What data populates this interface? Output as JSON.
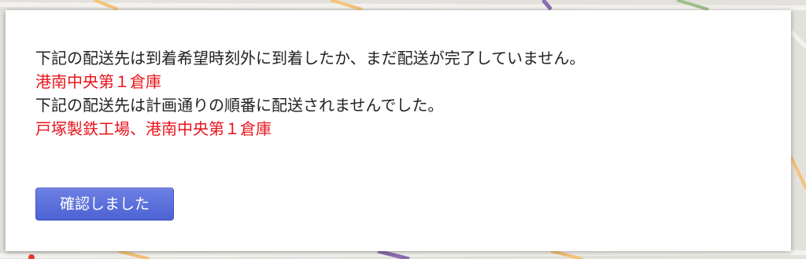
{
  "dialog": {
    "lines": [
      "下記の配送先は到着希望時刻外に到着したか、まだ配送が完了していません。",
      "港南中央第１倉庫",
      "下記の配送先は計画通りの順番に配送されませんでした。",
      "戸塚製鉄工場、港南中央第１倉庫"
    ],
    "confirm_label": "確認しました"
  },
  "colors": {
    "alert_text": "#e8141c",
    "body_text": "#222222",
    "button": "#5a6fdc"
  }
}
